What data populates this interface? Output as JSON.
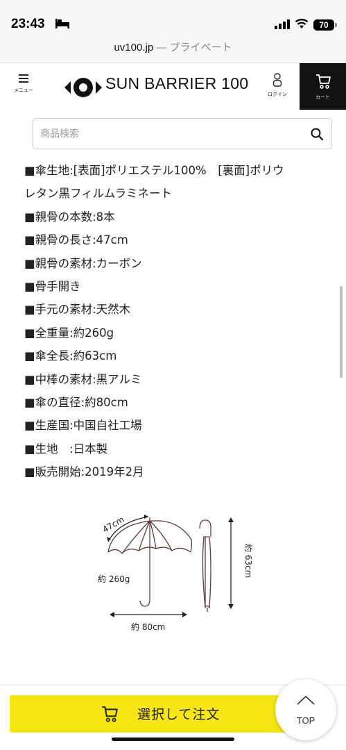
{
  "status_bar": {
    "time": "23:43",
    "battery": "70"
  },
  "browser": {
    "url": "uv100.jp",
    "private_label": " — プライベート"
  },
  "header": {
    "menu_label": "メニュー",
    "logo_text": "SUN BARRIER 100",
    "login_label": "ログイン",
    "cart_label": "カート"
  },
  "search": {
    "placeholder": "商品検索"
  },
  "specs": [
    "■傘生地:[表面]ポリエステル100%　[裏面]ポリウ",
    "レタン黒フィルムラミネート",
    "■親骨の本数:8本",
    "■親骨の長さ:47cm",
    "■親骨の素材:カーボン",
    "■骨手開き",
    "■手元の素材:天然木",
    "■全重量:約260g",
    "■傘全長:約63cm",
    "■中棒の素材:黒アルミ",
    "■傘の直径:約80cm",
    "■生産国:中国自社工場",
    "■生地　:日本製",
    "■販売開始:2019年2月"
  ],
  "diagram": {
    "rib_length": "47cm",
    "weight": "約 260g",
    "diameter": "約 80cm",
    "length": "約 63cm"
  },
  "order_bar": {
    "order_label": "選択して注文",
    "top_label": "TOP"
  },
  "colors": {
    "order_button": "#f5e614",
    "cart_button": "#111111",
    "canopy_stroke": "#5a3a3a"
  }
}
